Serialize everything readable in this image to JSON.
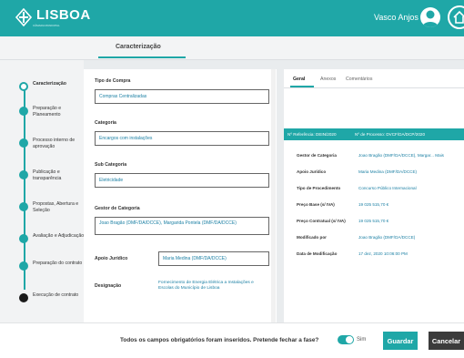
{
  "header": {
    "logo_text": "LISBOA",
    "logo_subtext": "CÂMARA MUNICIPAL",
    "user_name": "Vasco Anjos |"
  },
  "stage": {
    "title": "Caracterização"
  },
  "stepper": {
    "steps": [
      {
        "label": "Caracterização"
      },
      {
        "label": "Preparação e Planeamento"
      },
      {
        "label": "Processo interno de aprovação"
      },
      {
        "label": "Publicação e transparência"
      },
      {
        "label": "Propostas, Abertura e Seleção"
      },
      {
        "label": "Avaliação e Adjudicação"
      },
      {
        "label": "Preparação do contrato"
      },
      {
        "label": "Execução de contrato"
      }
    ]
  },
  "form": {
    "tipo_compra": {
      "label": "Tipo de Compra",
      "value": "Compras Centralizadas"
    },
    "categoria": {
      "label": "Categoria",
      "value": "Encargos com instalações"
    },
    "sub_categoria": {
      "label": "Sub Categoria",
      "value": "Eletricidade"
    },
    "gestor": {
      "label": "Gestor de Categoria",
      "value": "Joao Bragão (DMF/DA/DCCE), Margarida Pontela (DMF/DA/DCCE)"
    },
    "apoio": {
      "label": "Apoio Jurídico",
      "value": "Maria Medina (DMF/DA/DCCE)"
    },
    "designacao": {
      "label": "Designação",
      "value": "Fornecimento de Energia Elétrica a Instalações e Escolas do Município de Lisboa"
    }
  },
  "details": {
    "tabs": [
      {
        "label": "Geral"
      },
      {
        "label": "Anexos"
      },
      {
        "label": "Comentários"
      }
    ],
    "ref_label": "Nº Referência: DEIN/2020",
    "process_label": "Nº de Processo: DVCF/DA/DCP/2020",
    "rows": [
      {
        "key": "Gestor de Categoria",
        "value": "Joao Bragão (DMF/DA/DCCE), Margar... Mais"
      },
      {
        "key": "Apoio Jurídico",
        "value": "Maria Medina (DMF/DA/DCCE)"
      },
      {
        "key": "Tipo de Procedimento",
        "value": "Concurso Público Internacional"
      },
      {
        "key": "Preço Base (s/ IVA)",
        "value": "19 025 515,70 €"
      },
      {
        "key": "Preço Contratual (s/ IVA)",
        "value": "19 025 515,70 €"
      },
      {
        "key": "Modificado por",
        "value": "Joao Bragão (DMF/DA/DCCE)"
      },
      {
        "key": "Data de Modificação",
        "value": "17 dez, 2020 10:06:00 PM"
      }
    ]
  },
  "footer": {
    "message": "Todos os campos obrigatórios foram inseridos. Pretende fechar a fase?",
    "toggle_label": "Sim",
    "save_label": "Guardar",
    "cancel_label": "Cancelar"
  },
  "colors": {
    "accent": "#1fa7a7",
    "dark_button": "#3b3b3b",
    "value_text": "#1a7fa3"
  }
}
